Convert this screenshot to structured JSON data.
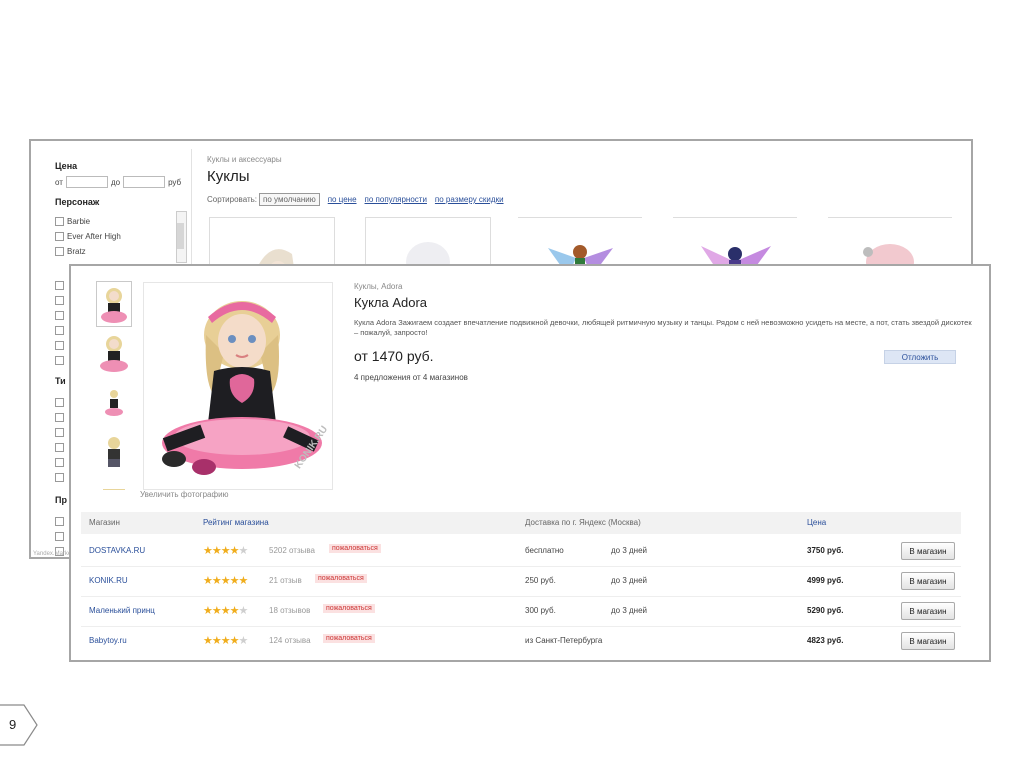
{
  "catalog": {
    "filters": {
      "price_title": "Цена",
      "price_from": "от",
      "price_to": "до",
      "price_currency": "руб",
      "character_title": "Персонаж",
      "characters": [
        "Barbie",
        "Ever After High",
        "Bratz"
      ],
      "type_title": "Ти",
      "producer_title": "Пр"
    },
    "breadcrumb": "Куклы и аксессуары",
    "title": "Куклы",
    "sort_label": "Сортировать:",
    "sort_active": "по умолчанию",
    "sort_links": [
      "по цене",
      "по популярности",
      "по размеру скидки"
    ],
    "footer_text": "Yandex.Market"
  },
  "product": {
    "breadcrumb": "Куклы, Adora",
    "title": "Кукла Adora",
    "description": "Кукла Adora Зажигаем создает впечатление подвижной девочки, любящей ритмичную музыку и танцы. Рядом с ней невозможно усидеть на месте, а пот, стать звездой дискотек – пожалуй, запросто!",
    "price": "от 1470 руб.",
    "offers": "4 предложения от 4 магазинов",
    "defer_button": "Отложить",
    "enlarge_link": "Увеличить фотографию",
    "watermark": "KONIK.RU",
    "table": {
      "headers": {
        "shop": "Магазин",
        "rating": "Рейтинг магазина",
        "delivery": "Доставка по г. Яндекс (Москва)",
        "price": "Цена"
      },
      "rows": [
        {
          "shop": "DOSTAVKA.RU",
          "stars": 4,
          "reviews": "5202 отзыва",
          "complain": "пожаловаться",
          "delivery": "бесплатно",
          "term": "до 3 дней",
          "price": "3750 руб.",
          "button": "В магазин"
        },
        {
          "shop": "KONIK.RU",
          "stars": 5,
          "reviews": "21 отзыв",
          "complain": "пожаловаться",
          "delivery": "250 руб.",
          "term": "до 3 дней",
          "price": "4999 руб.",
          "button": "В магазин"
        },
        {
          "shop": "Маленький принц",
          "stars": 4,
          "reviews": "18 отзывов",
          "complain": "пожаловаться",
          "delivery": "300 руб.",
          "term": "до 3 дней",
          "price": "5290 руб.",
          "button": "В магазин"
        },
        {
          "shop": "Babytoy.ru",
          "stars": 4,
          "reviews": "124 отзыва",
          "complain": "пожаловаться",
          "delivery": "из Санкт-Петербурга",
          "term": "",
          "price": "4823 руб.",
          "button": "В магазин"
        }
      ]
    }
  },
  "slide": {
    "number": "9"
  },
  "colors": {
    "link": "#2a4f9a",
    "star": "#f0ad1c",
    "frame": "#a6a6a6",
    "complain_bg": "#fbe1e1"
  }
}
